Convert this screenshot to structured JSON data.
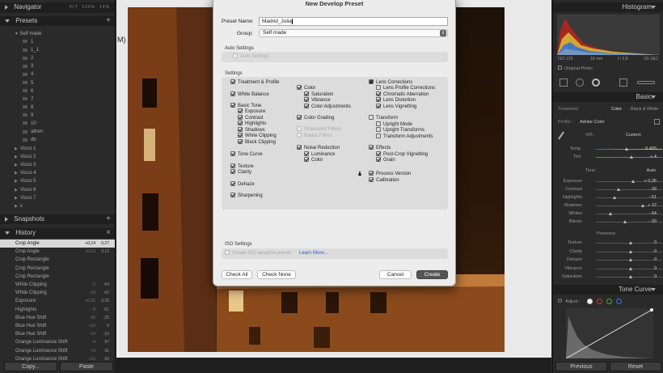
{
  "left": {
    "navigator": {
      "title": "Navigator",
      "zoom": [
        "FIT",
        "100%",
        "14%"
      ]
    },
    "presets": {
      "title": "Presets",
      "folder": "Self made",
      "items": [
        "1",
        "1_1",
        "2",
        "3",
        "4",
        "5",
        "6",
        "7",
        "8",
        "9",
        "10",
        "athen",
        "db"
      ],
      "folders": [
        "Visco 1",
        "Visco 2",
        "Visco 3",
        "Visco 4",
        "Visco 5",
        "Visco 6",
        "Visco 7",
        "x"
      ]
    },
    "snapshots": {
      "title": "Snapshots"
    },
    "history": {
      "title": "History",
      "rows": [
        {
          "name": "Crop Angle",
          "a": "+0,14",
          "b": "0,27"
        },
        {
          "name": "Crop Angle",
          "a": "+0,13",
          "b": "0,13"
        },
        {
          "name": "Crop Rectangle",
          "a": "",
          "b": ""
        },
        {
          "name": "Crop Rectangle",
          "a": "",
          "b": ""
        },
        {
          "name": "Crop Rectangle",
          "a": "",
          "b": ""
        },
        {
          "name": "White Clipping",
          "a": "-2",
          "b": "-64"
        },
        {
          "name": "White Clipping",
          "a": "-19",
          "b": "-62"
        },
        {
          "name": "Exposure",
          "a": "+0,35",
          "b": "0,35"
        },
        {
          "name": "Highlights",
          "a": "-8",
          "b": "-51"
        },
        {
          "name": "Blue Hue Shift",
          "a": "-25",
          "b": "-25"
        },
        {
          "name": "Blue Hue Shift",
          "a": "+10",
          "b": "0"
        },
        {
          "name": "Blue Hue Shift",
          "a": "-10",
          "b": "-10"
        },
        {
          "name": "Orange Luminance Shift",
          "a": "-4",
          "b": "87"
        },
        {
          "name": "Orange Luminance Shift",
          "a": "+9",
          "b": "91"
        },
        {
          "name": "Orange Luminance Shift",
          "a": "+12",
          "b": "82"
        }
      ]
    },
    "copy": "Copy...",
    "paste": "Paste"
  },
  "dialog": {
    "title": "New Develop Preset",
    "preset_name_label": "Preset Name:",
    "preset_name_value": "Madrid_Julia",
    "group_label": "Group:",
    "group_value": "Self made",
    "auto_settings_title": "Auto Settings",
    "auto_settings_item": "Auto Settings",
    "settings_title": "Settings",
    "col1": [
      {
        "label": "Treatment & Profile",
        "on": true,
        "indent": 0
      },
      {
        "label": "White Balance",
        "on": true,
        "indent": 0
      },
      {
        "label": "Basic Tone",
        "on": true,
        "indent": 0
      },
      {
        "label": "Exposure",
        "on": true,
        "indent": 1
      },
      {
        "label": "Contrast",
        "on": true,
        "indent": 1
      },
      {
        "label": "Highlights",
        "on": true,
        "indent": 1
      },
      {
        "label": "Shadows",
        "on": true,
        "indent": 1
      },
      {
        "label": "White Clipping",
        "on": true,
        "indent": 1
      },
      {
        "label": "Black Clipping",
        "on": true,
        "indent": 1
      },
      {
        "label": "Tone Curve",
        "on": true,
        "indent": 0
      },
      {
        "label": "Texture",
        "on": true,
        "indent": 0
      },
      {
        "label": "Clarity",
        "on": true,
        "indent": 0
      },
      {
        "label": "Dehaze",
        "on": true,
        "indent": 0
      },
      {
        "label": "Sharpening",
        "on": true,
        "indent": 0
      }
    ],
    "col2": [
      {
        "label": "Color",
        "on": true,
        "indent": 0
      },
      {
        "label": "Saturation",
        "on": true,
        "indent": 1
      },
      {
        "label": "Vibrance",
        "on": true,
        "indent": 1
      },
      {
        "label": "Color Adjustments",
        "on": true,
        "indent": 1
      },
      {
        "label": "Color Grading",
        "on": true,
        "indent": 0
      },
      {
        "label": "Graduated Filters",
        "on": false,
        "indent": 0,
        "dim": true
      },
      {
        "label": "Radial Filters",
        "on": false,
        "indent": 0,
        "dim": true
      },
      {
        "label": "Noise Reduction",
        "on": true,
        "indent": 0
      },
      {
        "label": "Luminance",
        "on": true,
        "indent": 1
      },
      {
        "label": "Color",
        "on": true,
        "indent": 1
      }
    ],
    "col3": [
      {
        "label": "Lens Corrections",
        "on": true,
        "indent": 0,
        "mixed": true
      },
      {
        "label": "Lens Profile Corrections",
        "on": false,
        "indent": 1
      },
      {
        "label": "Chromatic Aberration",
        "on": true,
        "indent": 1
      },
      {
        "label": "Lens Distortion",
        "on": true,
        "indent": 1
      },
      {
        "label": "Lens Vignetting",
        "on": true,
        "indent": 1
      },
      {
        "label": "Transform",
        "on": false,
        "indent": 0
      },
      {
        "label": "Upright Mode",
        "on": false,
        "indent": 1
      },
      {
        "label": "Upright Transforms",
        "on": false,
        "indent": 1
      },
      {
        "label": "Transform Adjustments",
        "on": false,
        "indent": 1
      },
      {
        "label": "Effects",
        "on": true,
        "indent": 0
      },
      {
        "label": "Post-Crop Vignetting",
        "on": true,
        "indent": 1
      },
      {
        "label": "Grain",
        "on": true,
        "indent": 1
      },
      {
        "label": "Process Version",
        "on": true,
        "indent": 0
      },
      {
        "label": "Calibration",
        "on": true,
        "indent": 0
      }
    ],
    "iso_title": "ISO Settings",
    "iso_item": "Create ISO adaptive preset",
    "learn_more": "Learn More...",
    "check_all": "Check All",
    "check_none": "Check None",
    "cancel": "Cancel",
    "create": "Create"
  },
  "right": {
    "histogram": {
      "title": "Histogram",
      "iso": "ISO 125",
      "focal": "16 mm",
      "aperture": "f / 2,8",
      "shutter": "1/5 SEC",
      "original_photo": "Original Photo"
    },
    "basic": {
      "title": "Basic",
      "treatment": "Treatment",
      "color": "Color",
      "bw": "Black & White",
      "profile_label": "Profile :",
      "profile_value": "Adobe Color",
      "wb_label": "WB :",
      "wb_value": "Custom",
      "temp_label": "Temp",
      "temp_val": "6.495",
      "tint_label": "Tint",
      "tint_val": "+ 4",
      "tone_label": "Tone",
      "auto": "Auto",
      "tone": [
        {
          "label": "Exposure",
          "val": "+ 0,35",
          "pos": 0.54
        },
        {
          "label": "Contrast",
          "val": "- 39",
          "pos": 0.32
        },
        {
          "label": "Highlights",
          "val": "- 51",
          "pos": 0.25
        },
        {
          "label": "Shadows",
          "val": "+ 37",
          "pos": 0.68
        },
        {
          "label": "Whites",
          "val": "- 64",
          "pos": 0.2
        },
        {
          "label": "Blacks",
          "val": "- 20",
          "pos": 0.42
        }
      ],
      "presence_label": "Presence",
      "presence": [
        {
          "label": "Texture",
          "val": "0",
          "pos": 0.5
        },
        {
          "label": "Clarity",
          "val": "0",
          "pos": 0.5
        },
        {
          "label": "Dehaze",
          "val": "0",
          "pos": 0.5
        },
        {
          "label": "Vibrance",
          "val": "0",
          "pos": 0.5
        },
        {
          "label": "Saturation",
          "val": "0",
          "pos": 0.5
        }
      ]
    },
    "tone_curve": {
      "title": "Tone Curve",
      "adjust": "Adjust :"
    },
    "previous": "Previous",
    "reset": "Reset"
  }
}
